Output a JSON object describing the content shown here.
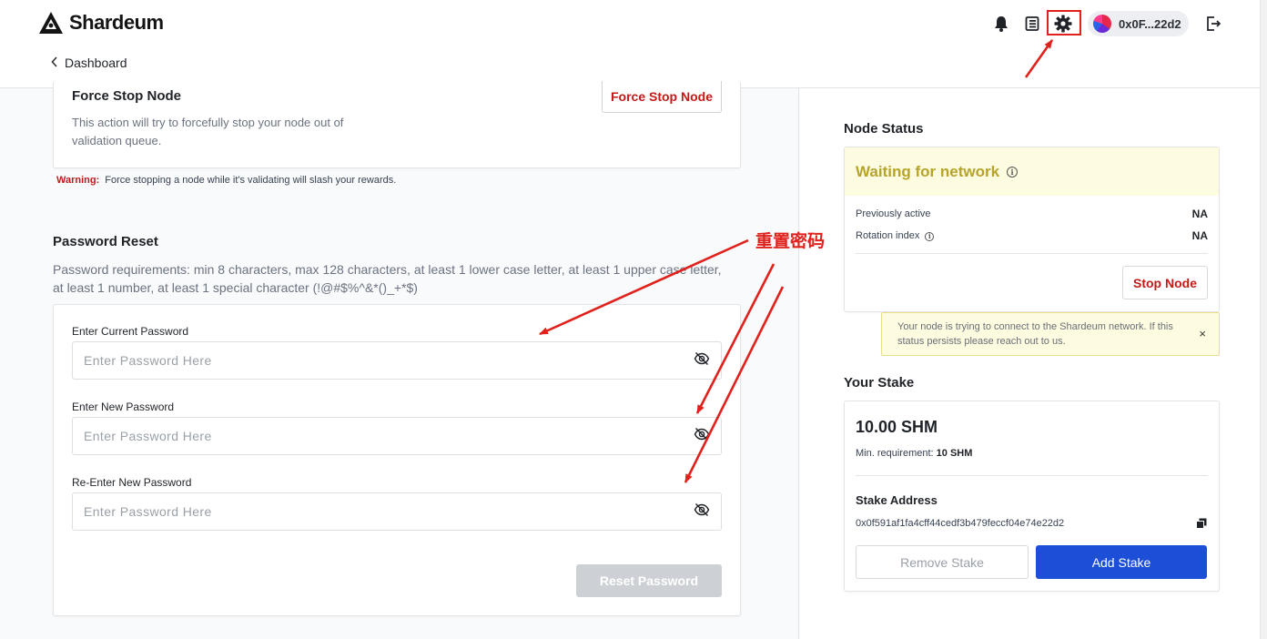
{
  "header": {
    "brand": "Shardeum",
    "back_label": "Dashboard",
    "wallet_address": "0x0F...22d2"
  },
  "force_stop": {
    "title": "Force Stop Node",
    "description": "This action will try to forcefully stop your node out of validation queue.",
    "button_label": "Force Stop Node",
    "warning_label": "Warning:",
    "warning_text": "Force stopping a node while it's validating will slash your rewards."
  },
  "password_reset": {
    "title": "Password Reset",
    "requirements": "Password requirements: min 8 characters, max 128 characters, at least 1 lower case letter, at least 1 upper case letter, at least 1 number, at least 1 special character (!@#$%^&*()_+*$)",
    "fields": [
      {
        "label": "Enter Current Password",
        "placeholder": "Enter Password Here",
        "value": ""
      },
      {
        "label": "Enter New Password",
        "placeholder": "Enter Password Here",
        "value": ""
      },
      {
        "label": "Re-Enter New Password",
        "placeholder": "Enter Password Here",
        "value": ""
      }
    ],
    "submit_label": "Reset Password"
  },
  "node_status": {
    "title": "Node Status",
    "status": "Waiting for network",
    "previously_active_label": "Previously active",
    "previously_active_value": "NA",
    "rotation_index_label": "Rotation index",
    "rotation_index_value": "NA",
    "stop_label": "Stop Node",
    "alert_text": "Your node is trying to connect to the Shardeum network. If this status persists please reach out to us.",
    "alert_close": "×"
  },
  "stake": {
    "title": "Your Stake",
    "amount": "10.00 SHM",
    "min_label": "Min. requirement:",
    "min_value": "10 SHM",
    "address_label": "Stake Address",
    "address": "0x0f591af1fa4cff44cedf3b479feccf04e74e22d2",
    "remove_label": "Remove Stake",
    "add_label": "Add Stake"
  },
  "annotation": {
    "text": "重置密码",
    "color": "#e0211c"
  },
  "icons": [
    "shardeum-logo-icon",
    "bell-icon",
    "book-icon",
    "gear-icon",
    "logout-icon",
    "chevron-left-icon",
    "eye-off-icon",
    "info-icon",
    "copy-icon",
    "close-icon"
  ]
}
